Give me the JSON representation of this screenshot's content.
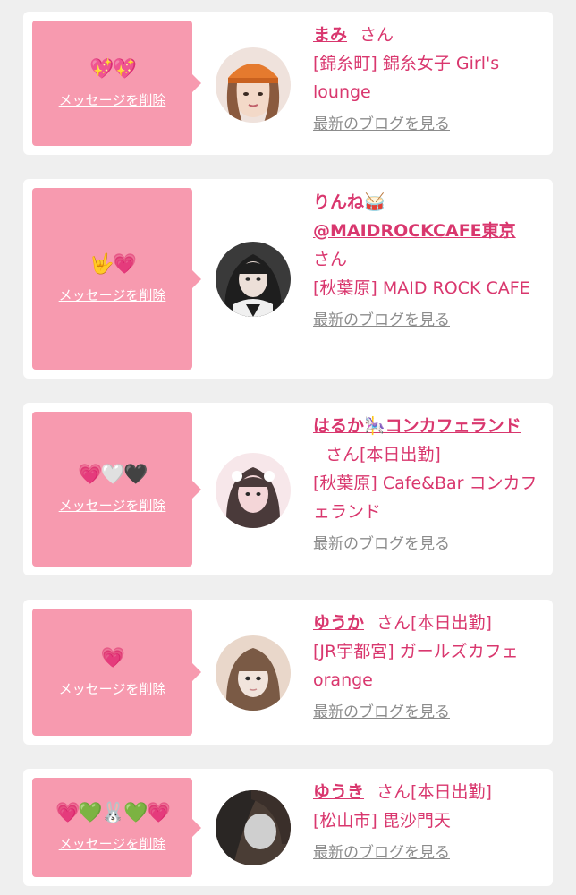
{
  "delete_label": "メッセージを削除",
  "san_label": "さん",
  "blog_label": "最新のブログを見る",
  "cards": [
    {
      "stamp": "💖💖",
      "name": "まみ",
      "status": "",
      "shop": "[錦糸町] 錦糸女子 Girl's lounge",
      "avatar_colors": [
        "#f3d9c8",
        "#e57a2e",
        "#d9b3a0"
      ]
    },
    {
      "stamp": "🤟💗",
      "name": "りんね🥁@MAIDROCKCAFE東京",
      "status": "",
      "shop": "[秋葉原] MAID ROCK CAFE",
      "avatar_colors": [
        "#2b2b2b",
        "#e8dcd6",
        "#4a4a4a"
      ]
    },
    {
      "stamp": "💗🤍🖤",
      "name": "はるか🎠コンカフェランド",
      "status": "[本日出勤]",
      "shop": "[秋葉原] Cafe&Bar コンカフェランド",
      "avatar_colors": [
        "#f4d6d8",
        "#4a3a3a",
        "#f7e7ea"
      ]
    },
    {
      "stamp": "💗",
      "name": "ゆうか",
      "status": "[本日出勤]",
      "shop": "[JR宇都宮] ガールズカフェ orange",
      "avatar_colors": [
        "#f1e4dc",
        "#7a5a45",
        "#e9d7ca"
      ]
    },
    {
      "stamp": "💗💚🐰💚💗",
      "name": "ゆうき",
      "status": "[本日出勤]",
      "shop": "[松山市] 毘沙門天",
      "avatar_colors": [
        "#2a2624",
        "#cfcfcf",
        "#4a3d35"
      ]
    }
  ]
}
